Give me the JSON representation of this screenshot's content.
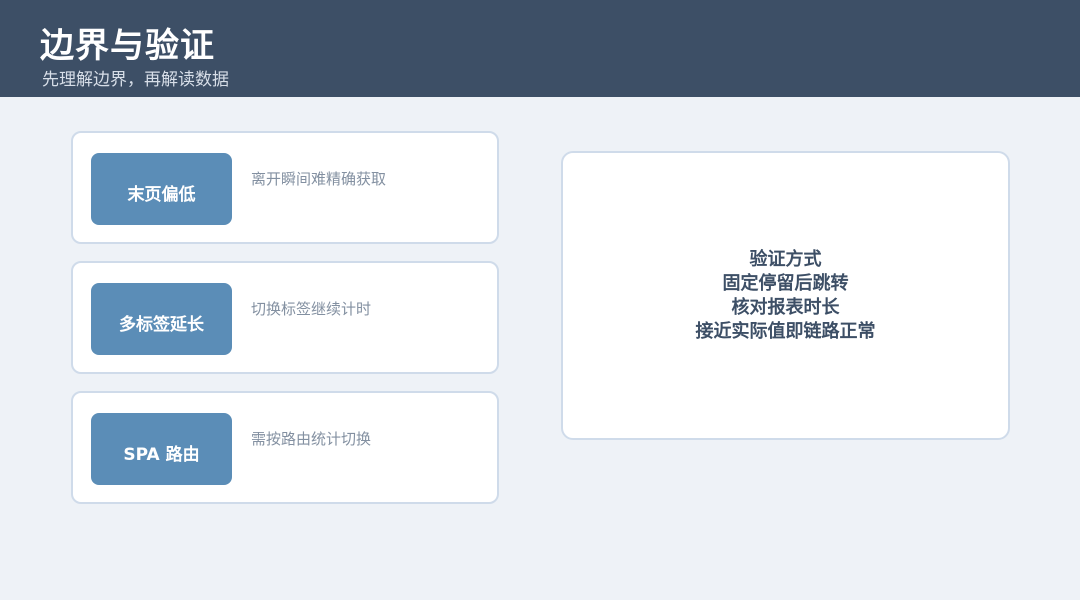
{
  "header": {
    "title": "边界与验证",
    "subtitle": "先理解边界，再解读数据"
  },
  "items": [
    {
      "tag": "末页偏低",
      "desc": "离开瞬间难精确获取"
    },
    {
      "tag": "多标签延长",
      "desc": "切换标签继续计时"
    },
    {
      "tag": "SPA 路由",
      "desc": "需按路由统计切换"
    }
  ],
  "verification": {
    "lines": [
      "验证方式",
      "固定停留后跳转",
      "核对报表时长",
      "接近实际值即链路正常"
    ]
  },
  "colors": {
    "header_bg": "#3d4f66",
    "tag_bg": "#5b8db7",
    "page_bg": "#eef2f7"
  }
}
